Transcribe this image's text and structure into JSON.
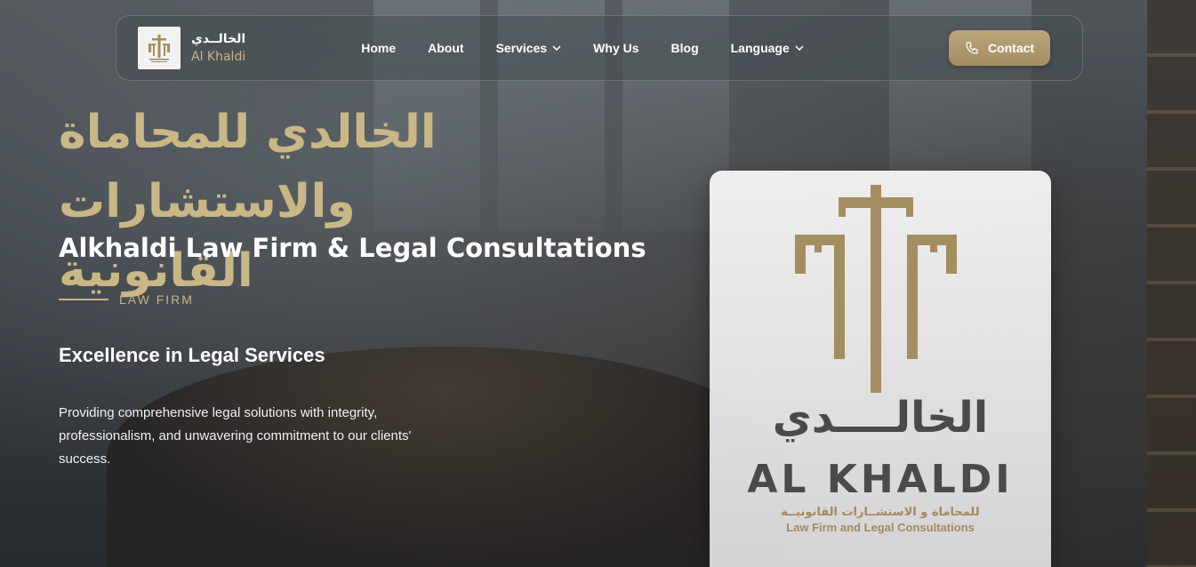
{
  "brand": {
    "name_ar": "الخالــدي",
    "name_en": "Al Khaldi"
  },
  "nav": {
    "items": [
      {
        "label": "Home",
        "has_dropdown": false
      },
      {
        "label": "About",
        "has_dropdown": false
      },
      {
        "label": "Services",
        "has_dropdown": true
      },
      {
        "label": "Why Us",
        "has_dropdown": false
      },
      {
        "label": "Blog",
        "has_dropdown": false
      },
      {
        "label": "Language",
        "has_dropdown": true
      }
    ],
    "contact_label": "Contact"
  },
  "hero": {
    "title_ar_line1": "الخالدي للمحاماة",
    "title_ar_line2": "والاستشارات القانونية",
    "title_en": "Alkhaldi Law Firm & Legal Consultations",
    "eyebrow": "LAW FIRM",
    "sub_heading": "Excellence in Legal Services",
    "description": "Providing comprehensive legal solutions with integrity, professionalism, and unwavering commitment to our clients' success."
  },
  "logo_card": {
    "name_ar": "الخالــــدي",
    "name_en": "AL KHALDI",
    "sub_ar": "للمحاماة و الاستشــارات القانونيــة",
    "sub_en": "Law Firm and Legal Consultations"
  },
  "colors": {
    "gold": "#c9b386",
    "gold_dark": "#a58d62",
    "card_text": "#4a4a4a"
  },
  "icons": [
    "phone-icon",
    "chevron-down-icon",
    "brand-logo-mark",
    "justice-emblem"
  ]
}
